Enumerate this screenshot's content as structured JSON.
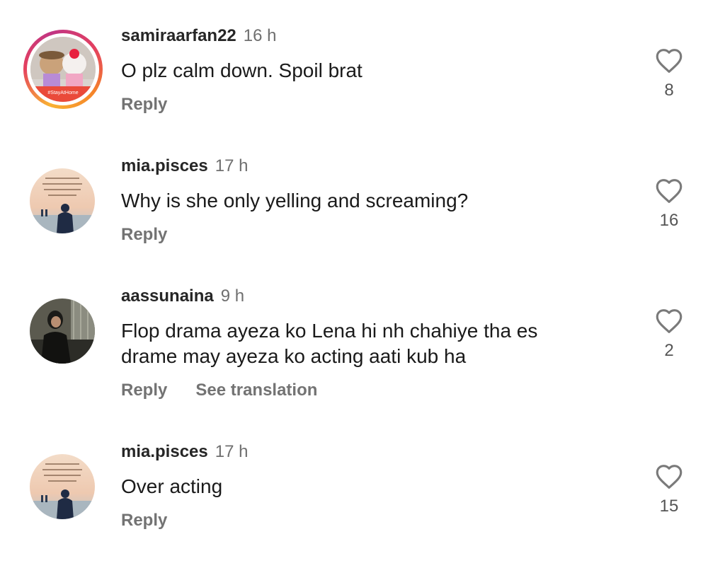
{
  "comments": [
    {
      "username": "samiraarfan22",
      "time": "16 h",
      "text": "O plz calm down.  Spoil brat",
      "reply_label": "Reply",
      "likes": "8",
      "avatar_caption": "#StayAtHome"
    },
    {
      "username": "mia.pisces",
      "time": "17 h",
      "text": "Why is she only yelling and screaming?",
      "reply_label": "Reply",
      "likes": "16"
    },
    {
      "username": "aassunaina",
      "time": "9 h",
      "text": "Flop drama ayeza ko Lena hi nh chahiye tha es drame may ayeza ko acting aati kub ha",
      "reply_label": "Reply",
      "translate_label": "See translation",
      "likes": "2"
    },
    {
      "username": "mia.pisces",
      "time": "17 h",
      "text": "Over acting",
      "reply_label": "Reply",
      "likes": "15"
    }
  ],
  "icons": {
    "like": "heart-outline-icon"
  },
  "colors": {
    "story_ring": "#e4405f",
    "meta_gray": "#737373"
  }
}
